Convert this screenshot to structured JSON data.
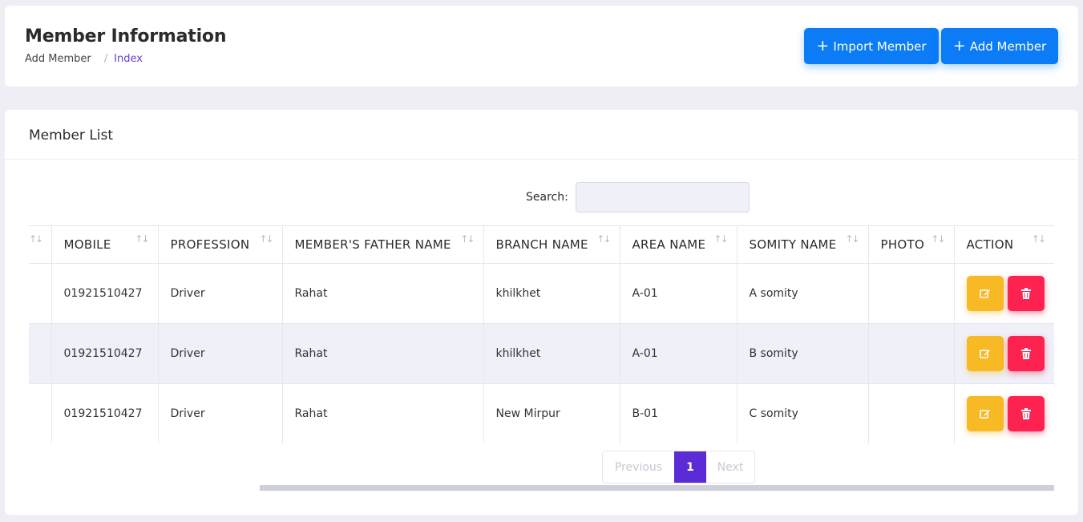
{
  "header": {
    "title": "Member Information",
    "breadcrumb": {
      "parent": "Add Member",
      "separator": "/",
      "current": "Index"
    },
    "import_button": {
      "icon": "plus-icon",
      "label": "Import Member"
    },
    "add_button": {
      "icon": "plus-icon",
      "label": "Add Member"
    }
  },
  "list": {
    "title": "Member List",
    "search_label": "Search:",
    "search_value": "",
    "columns": [
      "",
      "MOBILE",
      "PROFESSION",
      "MEMBER'S FATHER NAME",
      "BRANCH NAME",
      "AREA NAME",
      "SOMITY NAME",
      "PHOTO",
      "ACTION"
    ],
    "rows": [
      {
        "mobile": "01921510427",
        "profession": "Driver",
        "father": "Rahat",
        "branch": "khilkhet",
        "area": "A-01",
        "somity": "A somity",
        "photo": ""
      },
      {
        "mobile": "01921510427",
        "profession": "Driver",
        "father": "Rahat",
        "branch": "khilkhet",
        "area": "A-01",
        "somity": "B somity",
        "photo": ""
      },
      {
        "mobile": "01921510427",
        "profession": "Driver",
        "father": "Rahat",
        "branch": "New Mirpur",
        "area": "B-01",
        "somity": "C somity",
        "photo": ""
      }
    ],
    "row_actions": {
      "edit_icon": "edit-icon",
      "delete_icon": "trash-icon"
    },
    "pagination": {
      "previous": "Previous",
      "current_page": "1",
      "next": "Next"
    }
  },
  "colors": {
    "primary": "#0b7bf6",
    "warning": "#f7b924",
    "danger": "#fd2250",
    "page_active": "#5b2bd6",
    "breadcrumb_active": "#6a3fd1"
  }
}
